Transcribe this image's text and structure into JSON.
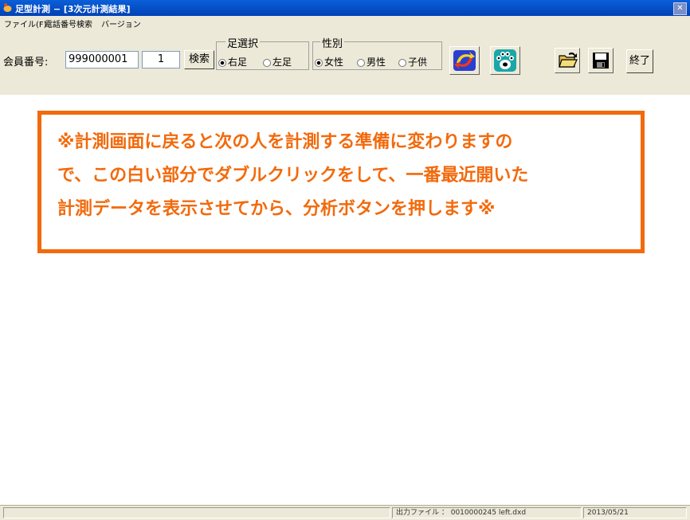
{
  "window": {
    "title": "足型計測 − [3次元計測結果]"
  },
  "menu": {
    "items": [
      "ファイル(F)",
      "電話番号検索",
      "バージョン"
    ]
  },
  "toolbar": {
    "member_label": "会員番号:",
    "member_value": "999000001",
    "count_value": "1",
    "search_label": "検索",
    "foot_group": {
      "caption": "足選択",
      "options": [
        "右足",
        "左足"
      ],
      "selected": "右足"
    },
    "gender_group": {
      "caption": "性別",
      "options": [
        "女性",
        "男性",
        "子供"
      ],
      "selected": "女性"
    },
    "exit_label": "終了"
  },
  "notice": {
    "lines": [
      "※計測画面に戻ると次の人を計測する準備に変わりますの",
      "で、この白い部分でダブルクリックをして、一番最近開いた",
      "計測データを表示させてから、分析ボタンを押します※"
    ],
    "color": "#f26a0c"
  },
  "status": {
    "output_file": "出力ファイル ： 0010000245 left.dxd",
    "date": "2013/05/21"
  }
}
